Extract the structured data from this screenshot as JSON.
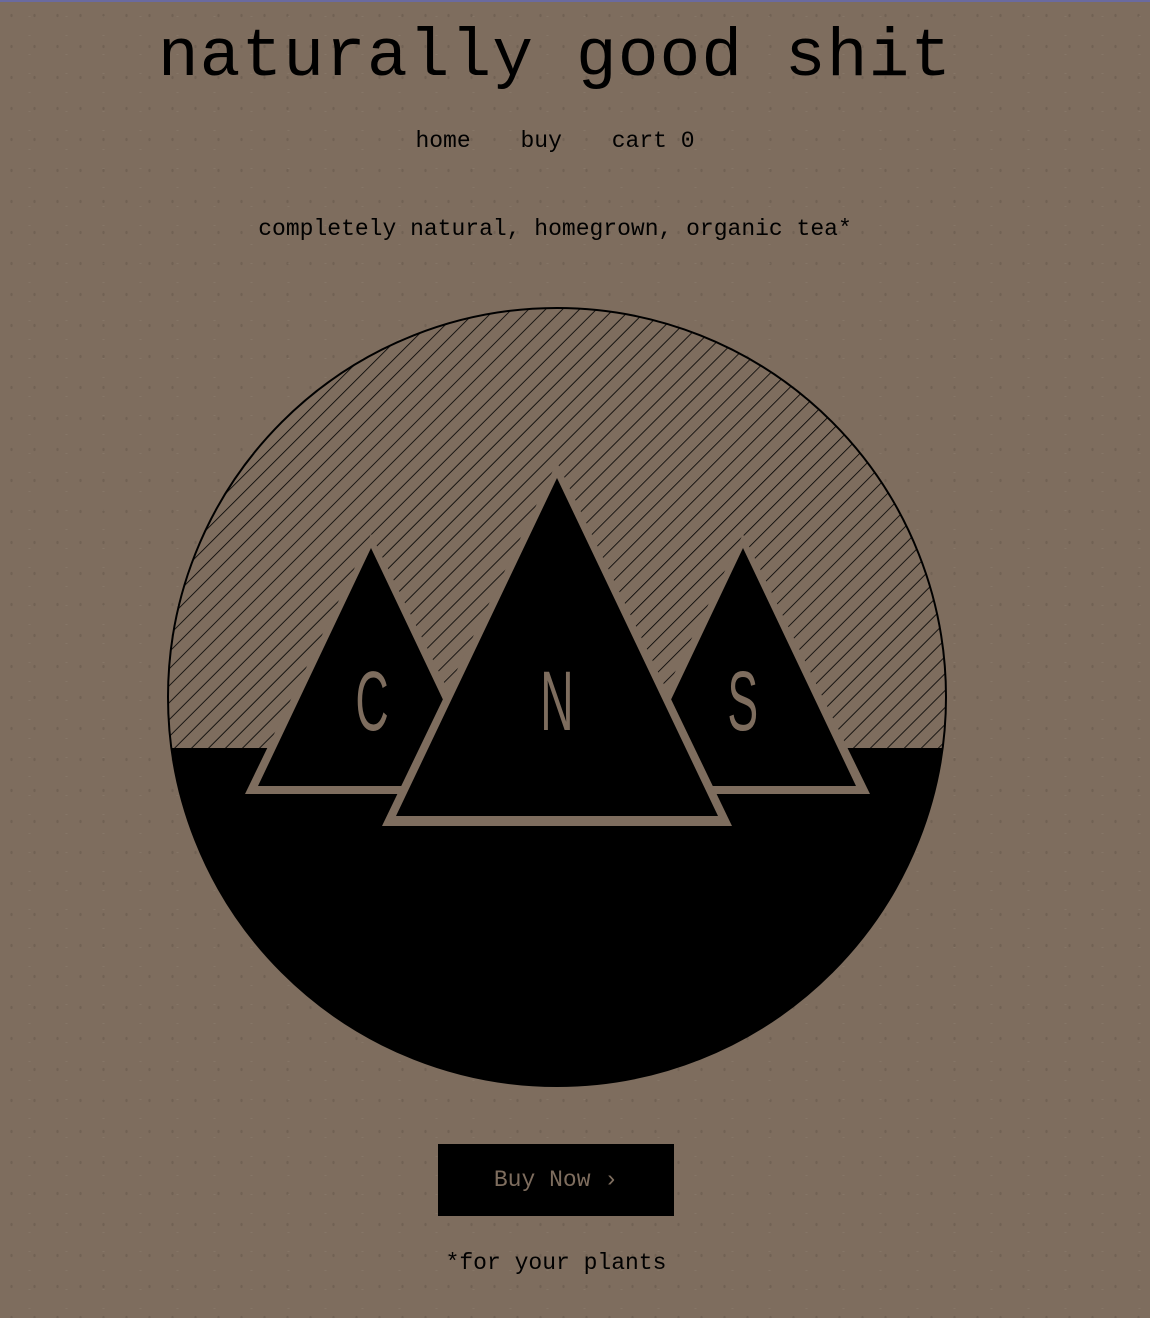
{
  "header": {
    "title": "naturally good shit"
  },
  "nav": {
    "items": [
      {
        "label": "home"
      },
      {
        "label": "buy"
      },
      {
        "label": "cart 0"
      }
    ]
  },
  "hero": {
    "tagline": "completely natural, homegrown, organic tea*",
    "logo": {
      "letters": [
        "C",
        "N",
        "S"
      ],
      "colors": {
        "background": "#7e6d5e",
        "ink": "#000000"
      }
    }
  },
  "cta": {
    "button_label": "Buy Now ›"
  },
  "footer": {
    "footnote": "*for your plants"
  }
}
